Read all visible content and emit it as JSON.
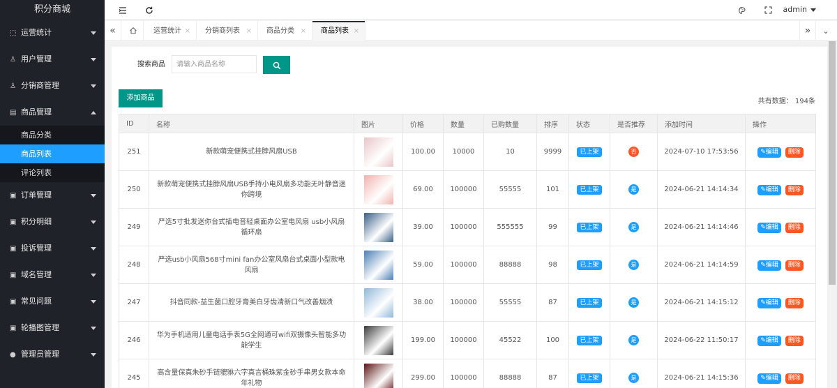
{
  "app": {
    "title": "积分商城"
  },
  "sidebar": {
    "items": [
      {
        "label": "运营统计",
        "icon": "monitor-icon"
      },
      {
        "label": "用户管理",
        "icon": "user-icon"
      },
      {
        "label": "分销商管理",
        "icon": "user-icon"
      },
      {
        "label": "商品管理",
        "icon": "document-icon",
        "sub": [
          {
            "label": "商品分类"
          },
          {
            "label": "商品列表",
            "active": true
          },
          {
            "label": "评论列表"
          }
        ]
      },
      {
        "label": "订单管理",
        "icon": "image-icon"
      },
      {
        "label": "积分明细",
        "icon": "image-icon"
      },
      {
        "label": "投诉管理",
        "icon": "image-icon"
      },
      {
        "label": "域名管理",
        "icon": "image-icon"
      },
      {
        "label": "常见问题",
        "icon": "image-icon"
      },
      {
        "label": "轮播图管理",
        "icon": "image-icon"
      },
      {
        "label": "管理员管理",
        "icon": "person-icon"
      }
    ]
  },
  "header": {
    "user": "admin"
  },
  "tabs": [
    {
      "label": "运营统计"
    },
    {
      "label": "分销商列表"
    },
    {
      "label": "商品分类"
    },
    {
      "label": "商品列表",
      "active": true
    }
  ],
  "search": {
    "label": "搜索商品",
    "placeholder": "请输入商品名称"
  },
  "toolbar": {
    "add_label": "添加商品",
    "total": "共有数据： 194条"
  },
  "table": {
    "headers": [
      "ID",
      "名称",
      "图片",
      "价格",
      "数量",
      "已购数量",
      "排序",
      "状态",
      "是否推荐",
      "添加时间",
      "操作"
    ],
    "rows": [
      {
        "id": "251",
        "name": "新款萌宠便携式挂脖风扇USB",
        "price": "100.00",
        "qty": "10000",
        "sold": "10",
        "sort": "9999",
        "status": "已上架",
        "rec": "否",
        "time": "2024-07-10 17:53:56",
        "thumb": "#e9c6c8"
      },
      {
        "id": "250",
        "name": "新款萌宠便携式挂脖风扇USB手持小电风扇多功能无叶静音迷你跨境",
        "price": "69.00",
        "qty": "100000",
        "sold": "55555",
        "sort": "101",
        "status": "已上架",
        "rec": "是",
        "time": "2024-06-21 14:14:34",
        "thumb": "#efb3ad"
      },
      {
        "id": "249",
        "name": "严选5寸批发迷你台式插电音轻桌面办公室电风扇 usb小风扇 循环扇",
        "price": "39.00",
        "qty": "100000",
        "sold": "555555",
        "sort": "99",
        "status": "已上架",
        "rec": "是",
        "time": "2024-06-21 14:14:46",
        "thumb": "#3a5f86"
      },
      {
        "id": "248",
        "name": "严选usb小风扇568寸mini fan办公室风扇台式桌面小型款电风扇",
        "price": "59.00",
        "qty": "100000",
        "sold": "88888",
        "sort": "98",
        "status": "已上架",
        "rec": "是",
        "time": "2024-06-21 14:14:59",
        "thumb": "#4a7fb4"
      },
      {
        "id": "247",
        "name": "抖音同款-益生菌口腔牙膏美白牙齿清新口气改善烟渍",
        "price": "38.00",
        "qty": "100000",
        "sold": "55555",
        "sort": "87",
        "status": "已上架",
        "rec": "是",
        "time": "2024-06-21 14:15:12",
        "thumb": "#8fb8d8"
      },
      {
        "id": "246",
        "name": "华为手机适用儿童电话手表5G全网通可wifi双摄像头智能多功能学生",
        "price": "199.00",
        "qty": "100000",
        "sold": "45522",
        "sort": "100",
        "status": "已上架",
        "rec": "是",
        "time": "2024-06-22 11:50:17",
        "thumb": "#3b3b3b"
      },
      {
        "id": "245",
        "name": "高含量保真朱砂手链貔貅六字真言桶珠紫金砂手串男女款本命年礼物",
        "price": "299.00",
        "qty": "100000",
        "sold": "88888",
        "sort": "87",
        "status": "已上架",
        "rec": "是",
        "time": "2024-06-21 14:15:36",
        "thumb": "#5a1414"
      }
    ],
    "edit_label": "编辑",
    "delete_label": "删除"
  },
  "colors": {
    "accent": "#009688",
    "blue": "#1e9fff",
    "red": "#ff5722",
    "sidebar": "#20222a"
  }
}
